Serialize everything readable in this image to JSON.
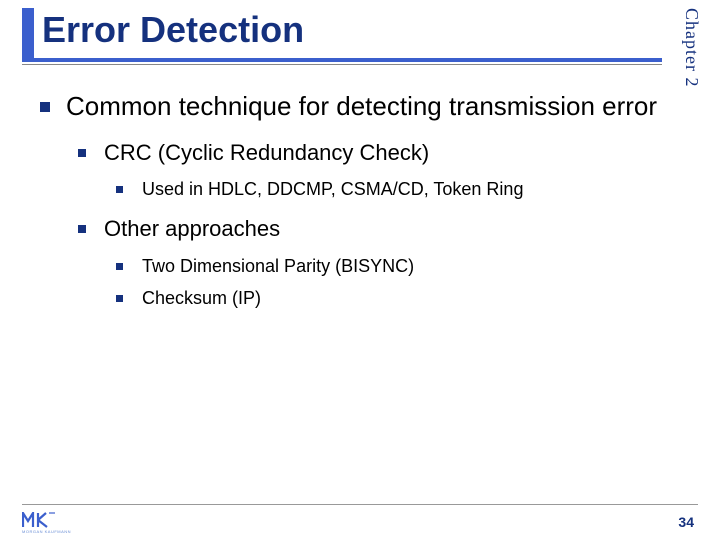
{
  "title": "Error Detection",
  "chapter_label": "Chapter 2",
  "bullets": {
    "b1": "Common technique for detecting transmission error",
    "b1_1": "CRC (Cyclic Redundancy Check)",
    "b1_1_1": "Used in HDLC, DDCMP, CSMA/CD, Token Ring",
    "b1_2": "Other approaches",
    "b1_2_1": "Two Dimensional Parity (BISYNC)",
    "b1_2_2": "Checksum (IP)"
  },
  "logo_sub": "MORGAN KAUFMANN",
  "page_number": "34"
}
